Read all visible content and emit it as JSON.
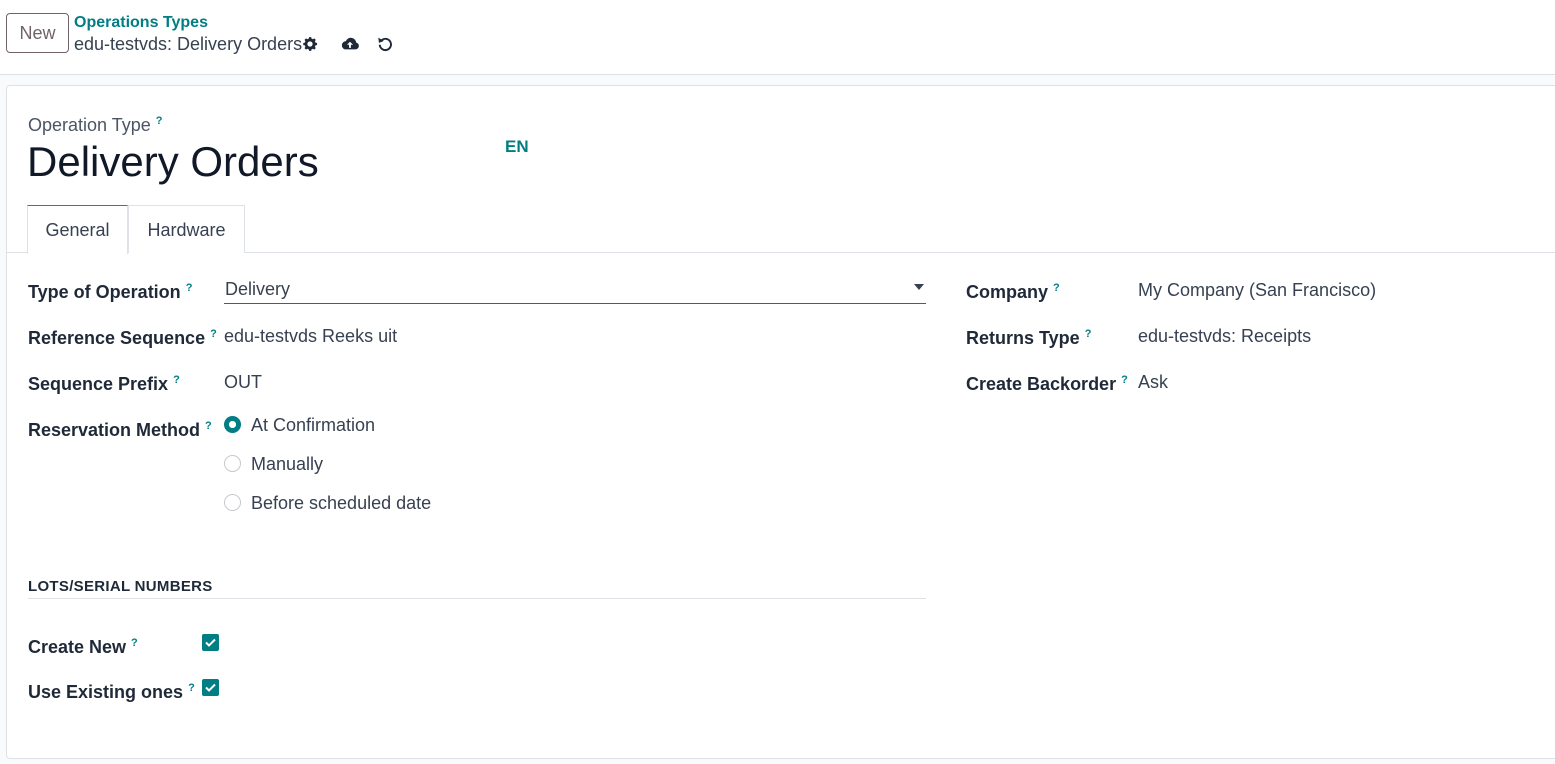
{
  "control_panel": {
    "new_button": "New",
    "breadcrumb_parent": "Operations Types",
    "breadcrumb_current": "edu-testvds: Delivery Orders"
  },
  "form": {
    "operation_type_label": "Operation Type",
    "help_mark": "?",
    "title": "Delivery Orders",
    "language": "EN"
  },
  "tabs": [
    {
      "label": "General",
      "active": true
    },
    {
      "label": "Hardware",
      "active": false
    }
  ],
  "left_fields": {
    "type_of_operation": {
      "label": "Type of Operation",
      "value": "Delivery"
    },
    "reference_sequence": {
      "label": "Reference Sequence",
      "value": "edu-testvds Reeks uit"
    },
    "sequence_prefix": {
      "label": "Sequence Prefix",
      "value": "OUT"
    },
    "reservation_method": {
      "label": "Reservation Method",
      "options": [
        {
          "label": "At Confirmation",
          "checked": true
        },
        {
          "label": "Manually",
          "checked": false
        },
        {
          "label": "Before scheduled date",
          "checked": false
        }
      ]
    }
  },
  "right_fields": {
    "company": {
      "label": "Company",
      "value": "My Company (San Francisco)"
    },
    "returns_type": {
      "label": "Returns Type",
      "value": "edu-testvds: Receipts"
    },
    "create_backorder": {
      "label": "Create Backorder",
      "value": "Ask"
    }
  },
  "lots_section": {
    "title": "LOTS/SERIAL NUMBERS",
    "create_new": {
      "label": "Create New",
      "checked": true
    },
    "use_existing": {
      "label": "Use Existing ones",
      "checked": true
    }
  },
  "colors": {
    "accent": "#017e84",
    "brand": "#71636b"
  },
  "icons": [
    "gear-icon",
    "cloud-upload-icon",
    "discard-icon",
    "caret-down-icon",
    "check-icon"
  ]
}
